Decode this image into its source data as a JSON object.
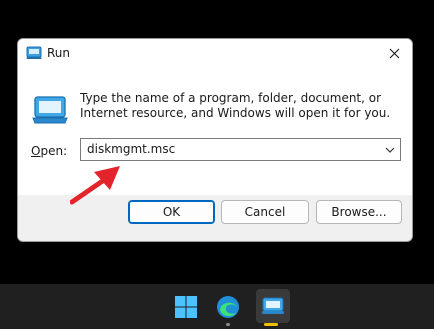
{
  "dialog": {
    "title": "Run",
    "description": "Type the name of a program, folder, document, or Internet resource, and Windows will open it for you.",
    "open_label_prefix": "O",
    "open_label_rest": "pen:",
    "input_value": "diskmgmt.msc"
  },
  "buttons": {
    "ok": "OK",
    "cancel": "Cancel",
    "browse": "Browse..."
  },
  "taskbar": {
    "items": [
      "start-icon",
      "edge-icon",
      "run-icon"
    ],
    "active_indicator_color": "#f2c200"
  },
  "colors": {
    "accent": "#0067c0",
    "annotation_arrow": "#e3242b"
  }
}
